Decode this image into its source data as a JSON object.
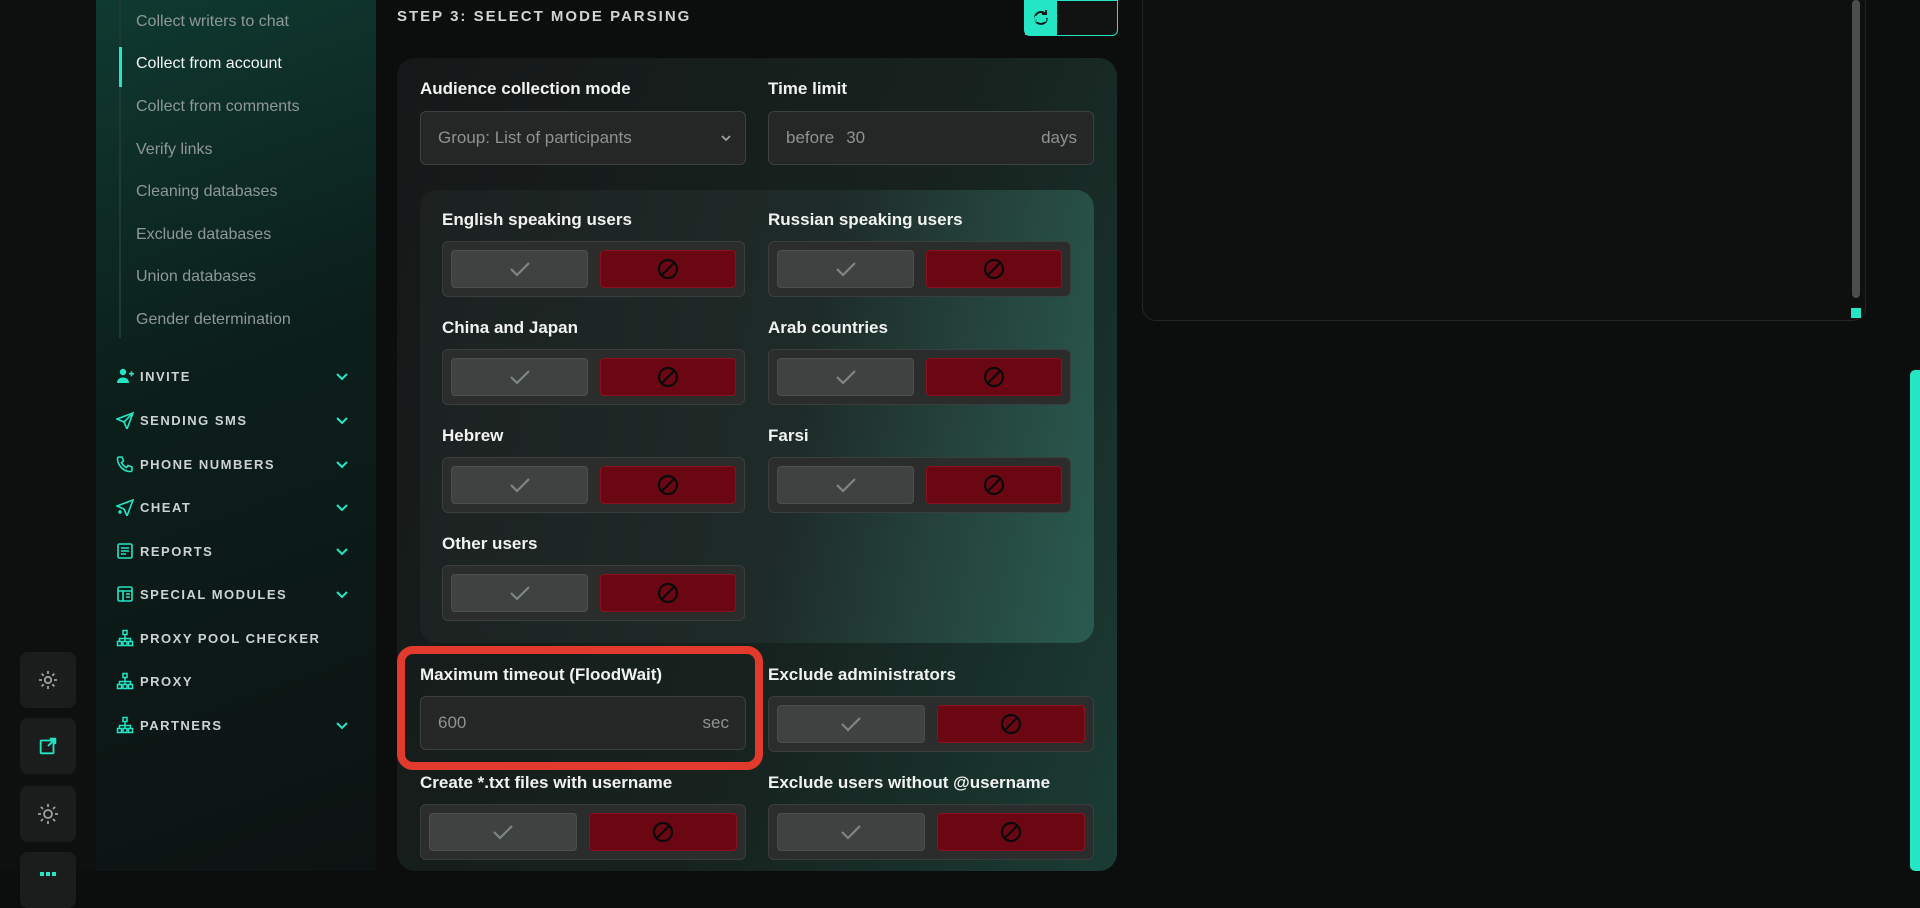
{
  "sidebar": {
    "subitems": [
      {
        "label": "Collect writers to chat"
      },
      {
        "label": "Collect from account"
      },
      {
        "label": "Collect from comments"
      },
      {
        "label": "Verify links"
      },
      {
        "label": "Cleaning databases"
      },
      {
        "label": "Exclude databases"
      },
      {
        "label": "Union databases"
      },
      {
        "label": "Gender determination"
      }
    ],
    "nav": [
      {
        "label": "INVITE",
        "icon": "user-plus-icon"
      },
      {
        "label": "SENDING SMS",
        "icon": "paper-plane-icon"
      },
      {
        "label": "PHONE NUMBERS",
        "icon": "phone-icon"
      },
      {
        "label": "CHEAT",
        "icon": "send-plus-icon"
      },
      {
        "label": "REPORTS",
        "icon": "report-icon"
      },
      {
        "label": "SPECIAL MODULES",
        "icon": "modules-icon"
      },
      {
        "label": "PROXY POOL CHECKER",
        "icon": "network-icon"
      },
      {
        "label": "PROXY",
        "icon": "network-icon"
      },
      {
        "label": "PARTNERS",
        "icon": "network-icon"
      }
    ]
  },
  "step": {
    "title": "STEP 3: SELECT MODE PARSING",
    "reset_label": "Reset"
  },
  "form": {
    "audience_mode": {
      "label": "Audience collection mode",
      "value": "Group: List of participants"
    },
    "time_limit": {
      "label": "Time limit",
      "prefix": "before",
      "value": "30",
      "suffix": "days"
    },
    "languages": [
      {
        "label": "English speaking users"
      },
      {
        "label": "Russian speaking users"
      },
      {
        "label": "China and Japan"
      },
      {
        "label": "Arab countries"
      },
      {
        "label": "Hebrew"
      },
      {
        "label": "Farsi"
      },
      {
        "label": "Other users"
      }
    ],
    "max_timeout": {
      "label": "Maximum timeout (FloodWait)",
      "value": "600",
      "suffix": "sec"
    },
    "exclude_admins": {
      "label": "Exclude administrators"
    },
    "create_txt": {
      "label": "Create *.txt files with username"
    },
    "exclude_no_username": {
      "label": "Exclude users without @username"
    }
  },
  "colors": {
    "accent": "#24e6c4",
    "deny": "#6a0713",
    "highlight": "#e23b2e"
  }
}
